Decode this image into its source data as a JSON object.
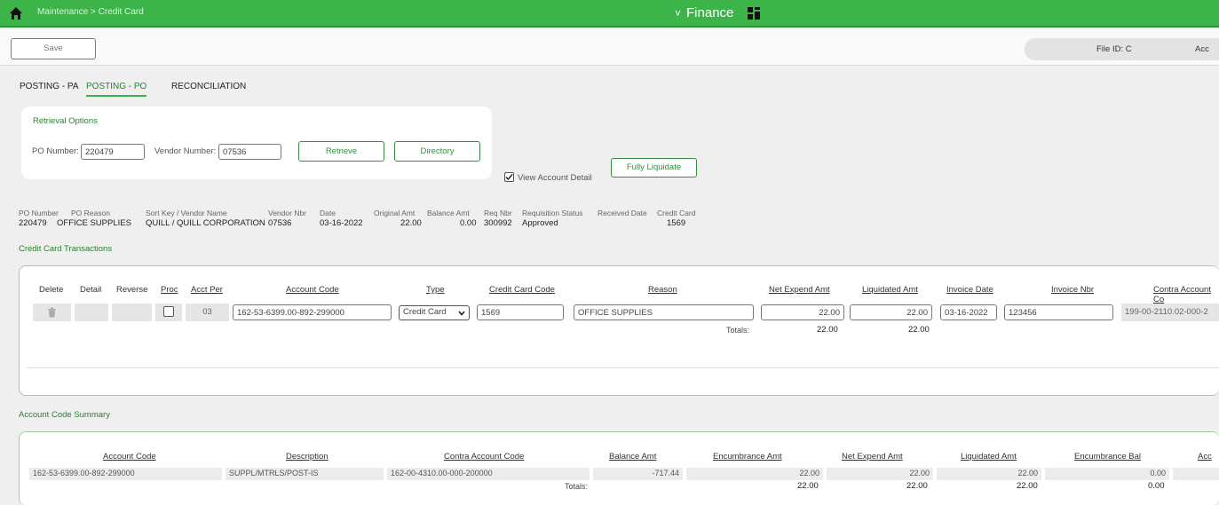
{
  "topbar": {
    "breadcrumb": "Maintenance > Credit Card",
    "app_name": "Finance",
    "app_chevron": "˅",
    "home_icon": "home-icon",
    "menu_icon": "grid-icon",
    "bg_color": "#3db44a"
  },
  "actionbar": {
    "save_label": "Save",
    "file_id_label": "File ID: C",
    "acc_label": "Acc"
  },
  "tabs": [
    {
      "label": "POSTING - PA",
      "active": false
    },
    {
      "label": "POSTING - PO",
      "active": true
    },
    {
      "label": "RECONCILIATION",
      "active": false
    }
  ],
  "retrieval": {
    "title": "Retrieval Options",
    "po_number_label": "PO Number:",
    "po_number_value": "220479",
    "vendor_number_label": "Vendor Number:",
    "vendor_number_value": "07536",
    "retrieve_label": "Retrieve",
    "directory_label": "Directory",
    "view_account_detail_label": "View Account Detail",
    "view_account_detail_checked": true,
    "fully_liquidate_label": "Fully Liquidate"
  },
  "po_info": {
    "headers": [
      "PO Number",
      "PO Reason",
      "Sort Key / Vendor Name",
      "Vendor Nbr",
      "Date",
      "Original Amt",
      "Balance Amt",
      "Req Nbr",
      "Requisition Status",
      "Received Date",
      "Credit Card"
    ],
    "po_number": "220479",
    "po_reason": "OFFICE SUPPLIES",
    "vendor_name": "QUILL / QUILL CORPORATION",
    "vendor_nbr": "07536",
    "date": "03-16-2022",
    "original_amt": "22.00",
    "balance_amt": "0.00",
    "req_nbr": "300992",
    "requisition_status": "Approved",
    "received_date": "",
    "credit_card": "1569"
  },
  "transactions": {
    "title": "Credit Card Transactions",
    "columns": {
      "delete": "Delete",
      "detail": "Detail",
      "reverse": "Reverse",
      "proc": "Proc",
      "acct_per": "Acct Per",
      "account_code": "Account Code",
      "type": "Type",
      "credit_card_code": "Credit Card Code",
      "reason": "Reason",
      "net_expend_amt": "Net Expend Amt",
      "liquidated_amt": "Liquidated Amt",
      "invoice_date": "Invoice Date",
      "invoice_nbr": "Invoice Nbr",
      "contra_account_code": "Contra Account Co"
    },
    "row": {
      "acct_per": "03",
      "account_code": "162-53-6399.00-892-299000",
      "type": "Credit Card",
      "credit_card_code": "1569",
      "reason": "OFFICE SUPPLIES",
      "net_expend_amt": "22.00",
      "liquidated_amt": "22.00",
      "invoice_date": "03-16-2022",
      "invoice_nbr": "123456",
      "contra_account_code": "199-00-2110.02-000-2"
    },
    "totals_label": "Totals:",
    "total_net_expend": "22.00",
    "total_liquidated": "22.00"
  },
  "summary": {
    "title": "Account Code Summary",
    "columns": {
      "account_code": "Account Code",
      "description": "Description",
      "contra_account_code": "Contra Account Code",
      "balance_amt": "Balance Amt",
      "encumbrance_amt": "Encumbrance Amt",
      "net_expend_amt": "Net Expend Amt",
      "liquidated_amt": "Liquidated Amt",
      "encumbrance_bal": "Encumbrance Bal",
      "acc": "Acc"
    },
    "row": {
      "account_code": "162-53-6399.00-892-299000",
      "description": "SUPPL/MTRLS/POST-IS",
      "contra_account_code": "162-00-4310.00-000-200000",
      "balance_amt": "-717.44",
      "encumbrance_amt": "22.00",
      "net_expend_amt": "22.00",
      "liquidated_amt": "22.00",
      "encumbrance_bal": "0.00"
    },
    "totals_label": "Totals:",
    "total_encumbrance": "22.00",
    "total_net_expend": "22.00",
    "total_liquidated": "22.00",
    "total_encumbrance_bal": "0.00"
  }
}
